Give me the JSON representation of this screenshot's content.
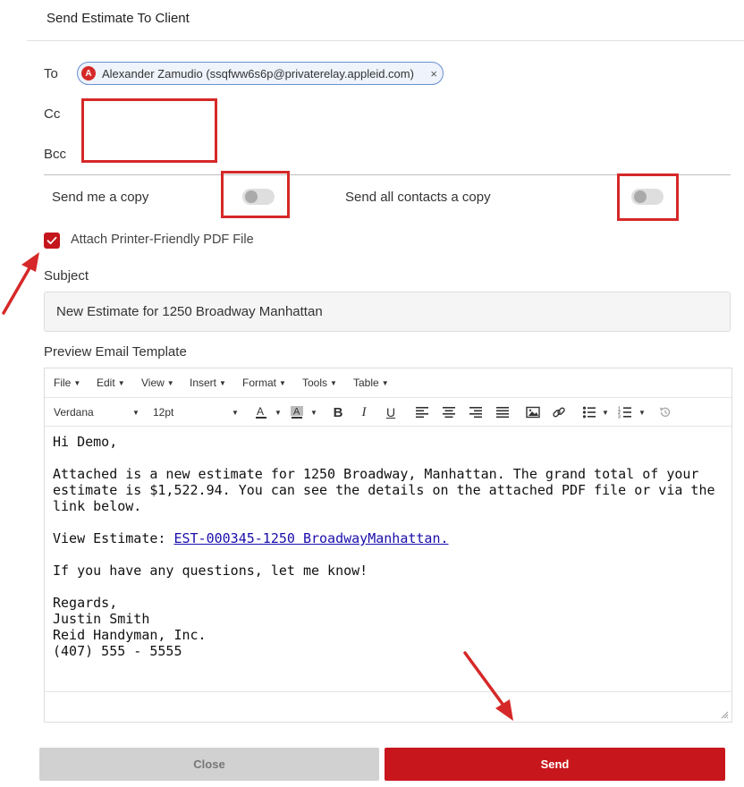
{
  "dialog": {
    "title": "Send Estimate To Client"
  },
  "recipients": {
    "to_label": "To",
    "cc_label": "Cc",
    "bcc_label": "Bcc",
    "to_chip": {
      "initial": "A",
      "text": "Alexander Zamudio (ssqfww6s6p@privaterelay.appleid.com)",
      "remove": "×"
    }
  },
  "options": {
    "send_me_copy_label": "Send me a copy",
    "send_me_copy_on": false,
    "send_all_contacts_label": "Send all contacts a copy",
    "send_all_contacts_on": false,
    "attach_pdf_label": "Attach Printer-Friendly PDF File",
    "attach_pdf_checked": true
  },
  "subject": {
    "label": "Subject",
    "value": "New Estimate for 1250 Broadway Manhattan"
  },
  "template": {
    "label": "Preview Email Template",
    "menus": [
      "File",
      "Edit",
      "View",
      "Insert",
      "Format",
      "Tools",
      "Table"
    ],
    "font_family": "Verdana",
    "font_size": "12pt",
    "body": {
      "greeting": "Hi Demo,",
      "paragraph": "Attached is a new estimate for 1250 Broadway, Manhattan. The grand total of your estimate is $1,522.94. You can see the details on the attached PDF file or via the link below.",
      "view_label": "View Estimate:",
      "view_link": "EST-000345-1250 BroadwayManhattan.",
      "questions": "If you have any questions, let me know!",
      "sign_off": "Regards,",
      "sig_name": "Justin Smith",
      "sig_company": "Reid Handyman, Inc.",
      "sig_phone": "(407) 555 - 5555"
    }
  },
  "actions": {
    "close_label": "Close",
    "send_label": "Send"
  },
  "colors": {
    "accent": "#c8161d",
    "highlight": "#d62828"
  }
}
